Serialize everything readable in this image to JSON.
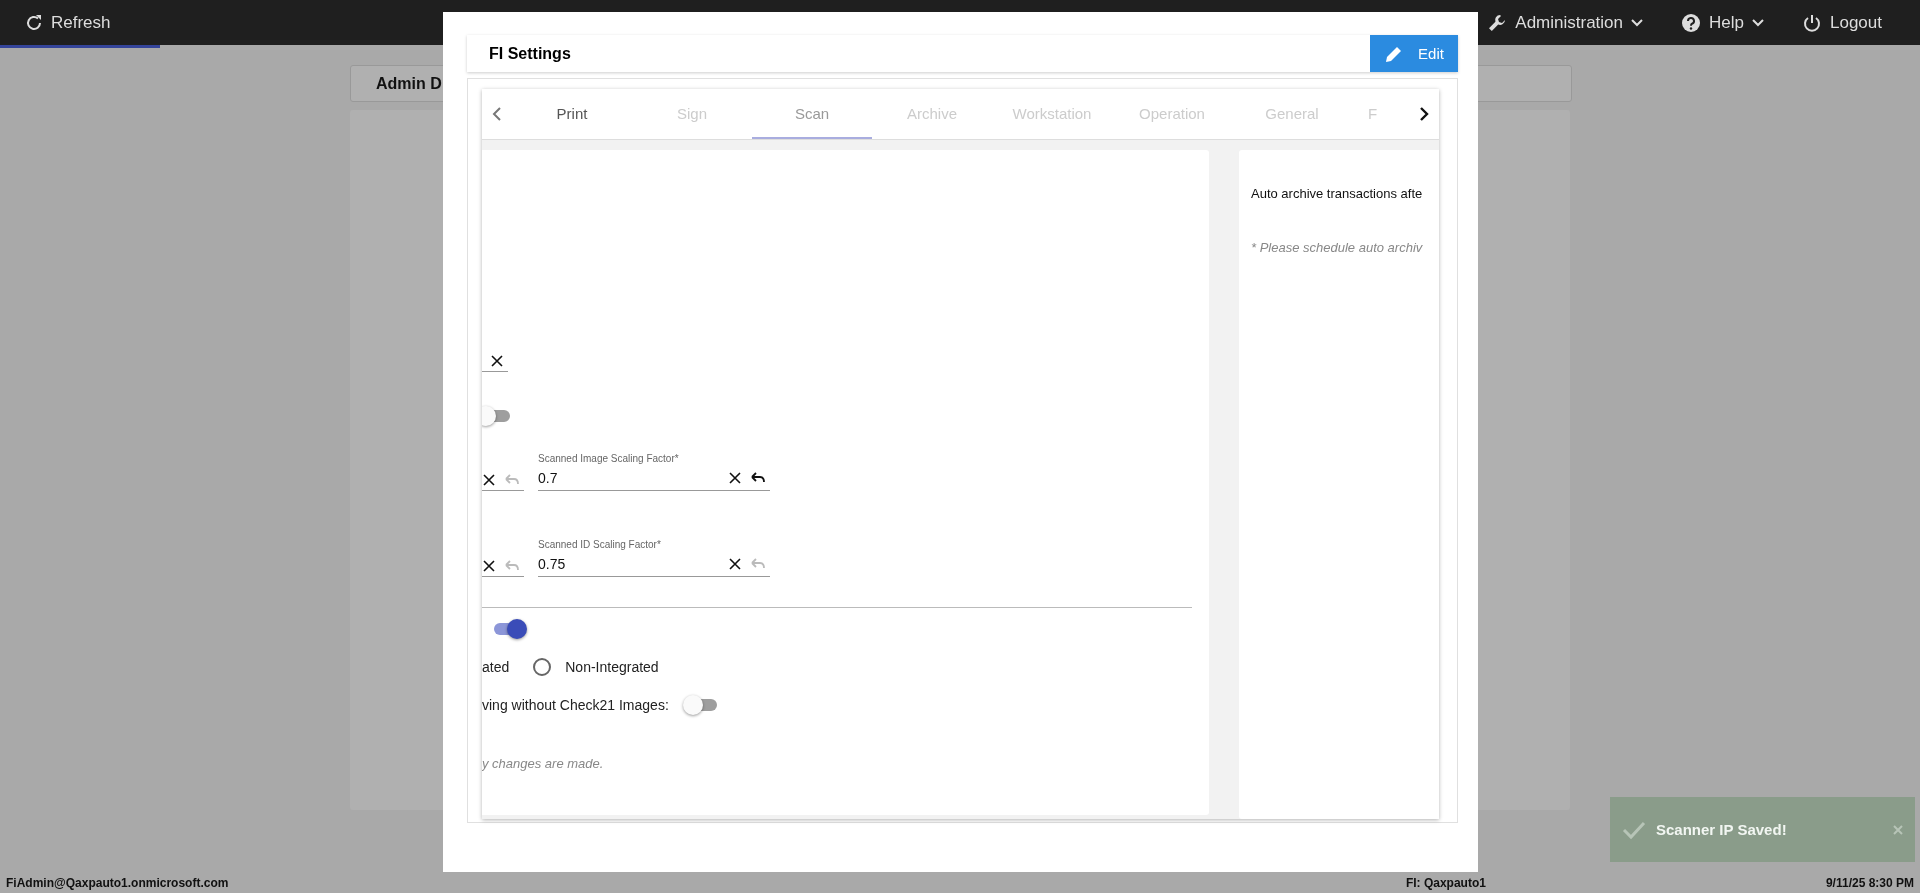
{
  "top_bar": {
    "refresh": "Refresh",
    "menus": [
      {
        "label": "Administration",
        "kind": "wrench"
      },
      {
        "label": "Help",
        "kind": "help"
      }
    ],
    "logout": "Logout"
  },
  "background": {
    "card_title": "Admin D"
  },
  "modal": {
    "title": "FI Settings",
    "edit_button": "Edit",
    "tabs": [
      {
        "label": "Print",
        "selected": false,
        "disabled": false
      },
      {
        "label": "Sign",
        "selected": false,
        "disabled": true
      },
      {
        "label": "Scan",
        "selected": true,
        "disabled": false
      },
      {
        "label": "Archive",
        "selected": false,
        "disabled": true
      },
      {
        "label": "Workstation",
        "selected": false,
        "disabled": true
      },
      {
        "label": "Operation",
        "selected": false,
        "disabled": true
      },
      {
        "label": "General",
        "selected": false,
        "disabled": true
      },
      {
        "label": "F",
        "selected": false,
        "disabled": true
      }
    ],
    "scan_rows": [
      {
        "kind": "clear-fragment"
      },
      {
        "kind": "toggle",
        "on": false
      },
      {
        "kind": "field-pair",
        "fields": [
          {
            "kind": "fragment",
            "undo_enabled": false
          },
          {
            "kind": "field",
            "label": "Scanned Image Scaling Factor*",
            "value": "0.7",
            "undo_enabled": true
          }
        ]
      },
      {
        "kind": "field-pair",
        "fields": [
          {
            "kind": "fragment",
            "undo_enabled": false
          },
          {
            "kind": "field",
            "label": "Scanned ID Scaling Factor*",
            "value": "0.75",
            "undo_enabled": false
          }
        ]
      },
      {
        "kind": "divider"
      },
      {
        "kind": "toggle",
        "on": true
      },
      {
        "kind": "radio",
        "options": [
          {
            "kind": "text",
            "label": "ated"
          },
          {
            "kind": "radio",
            "label": "Non-Integrated",
            "selected": false
          }
        ]
      },
      {
        "kind": "labeled-toggle",
        "label": "ving without Check21 Images:",
        "on": false
      },
      {
        "kind": "note",
        "text": "y changes are made."
      }
    ],
    "archive_panel": {
      "text": "Auto archive transactions afte",
      "note": "* Please schedule auto archiv"
    }
  },
  "toast": {
    "text": "Scanner IP Saved!"
  },
  "status_bar": {
    "user": "FiAdmin@Qaxpauto1.onmicrosoft.com",
    "fi": "FI: Qaxpauto1",
    "datetime": "9/11/25 8:30 PM"
  }
}
